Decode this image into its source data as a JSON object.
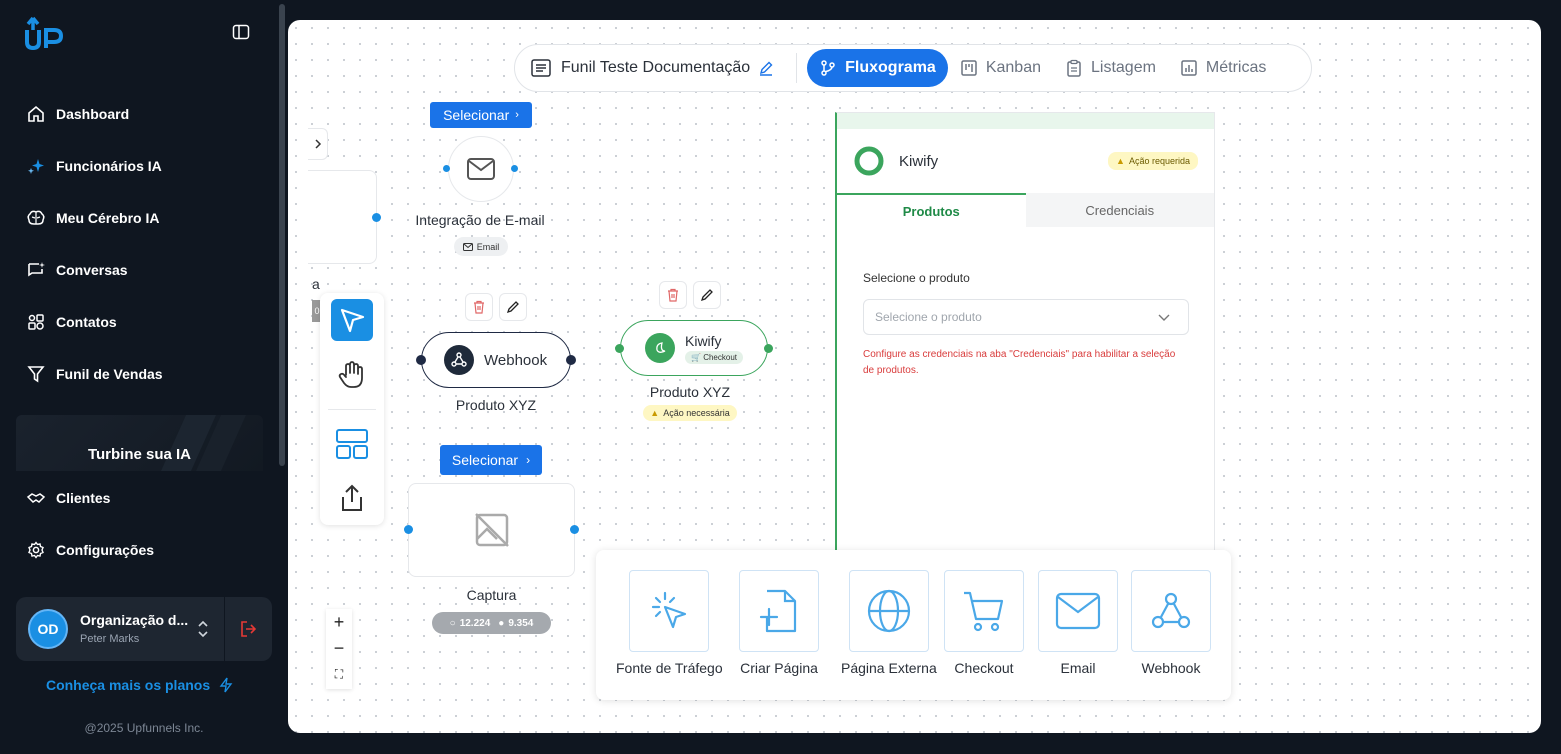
{
  "brand": {
    "logo_text": "UP",
    "accent": "#1a8fe3"
  },
  "sidebar": {
    "items": [
      {
        "label": "Dashboard",
        "icon": "home-icon"
      },
      {
        "label": "Funcionários IA",
        "icon": "sparkles-icon"
      },
      {
        "label": "Meu Cérebro IA",
        "icon": "brain-icon"
      },
      {
        "label": "Conversas",
        "icon": "chat-icon"
      },
      {
        "label": "Contatos",
        "icon": "contacts-icon"
      },
      {
        "label": "Funil de Vendas",
        "icon": "funnel-icon"
      }
    ],
    "promo": "Turbine sua IA",
    "items2": [
      {
        "label": "Clientes",
        "icon": "handshake-icon"
      },
      {
        "label": "Configurações",
        "icon": "gear-icon"
      }
    ],
    "org": {
      "initials": "OD",
      "name": "Organização d...",
      "user": "Peter Marks"
    },
    "plans_link": "Conheça mais os planos",
    "copyright": "@2025 Upfunnels Inc."
  },
  "topbar": {
    "funnel_name": "Funil Teste Documentação",
    "tabs": [
      {
        "label": "Fluxograma",
        "active": true
      },
      {
        "label": "Kanban",
        "active": false
      },
      {
        "label": "Listagem",
        "active": false
      },
      {
        "label": "Métricas",
        "active": false
      }
    ]
  },
  "canvas": {
    "email_node": {
      "select": "Selecionar",
      "title": "Integração de E-mail",
      "chip": "Email"
    },
    "partial_label": "a",
    "partial_chip": "0",
    "webhook_node": {
      "name": "Webhook",
      "title": "Produto XYZ"
    },
    "kiwify_node": {
      "name": "Kiwify",
      "chip": "Checkout",
      "title": "Produto XYZ",
      "warning": "Ação necessária"
    },
    "capture_node": {
      "select": "Selecionar",
      "title": "Captura",
      "stat1": "12.224",
      "stat2": "9.354"
    },
    "zoom": {
      "in": "+",
      "out": "−",
      "fit": "⛶"
    }
  },
  "panel": {
    "title": "Kiwify",
    "badge": "Ação requerida",
    "tabs": [
      {
        "label": "Produtos",
        "active": true
      },
      {
        "label": "Credenciais",
        "active": false
      }
    ],
    "field_label": "Selecione o produto",
    "select_placeholder": "Selecione o produto",
    "error": "Configure as credenciais na aba \"Credenciais\" para habilitar a seleção de produtos."
  },
  "palette": [
    {
      "label": "Fonte de Tráfego",
      "icon": "cursor-click-icon"
    },
    {
      "label": "Criar Página",
      "icon": "file-plus-icon"
    },
    {
      "label": "Página Externa",
      "icon": "globe-icon"
    },
    {
      "label": "Checkout",
      "icon": "cart-icon"
    },
    {
      "label": "Email",
      "icon": "mail-icon"
    },
    {
      "label": "Webhook",
      "icon": "webhook-icon"
    }
  ]
}
